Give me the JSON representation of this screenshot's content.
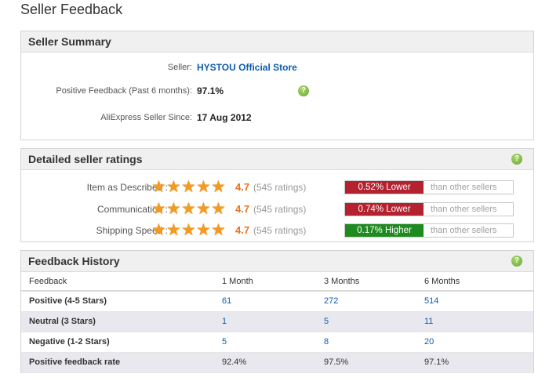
{
  "page": {
    "title": "Seller Feedback"
  },
  "summary": {
    "heading": "Seller Summary",
    "seller_label": "Seller:",
    "seller_name": "HYSTOU Official Store",
    "positive_label": "Positive Feedback (Past 6 months):",
    "positive_value": "97.1%",
    "since_label": "AliExpress Seller Since:",
    "since_value": "17 Aug 2012",
    "help_icon": "?"
  },
  "ratings": {
    "heading": "Detailed seller ratings",
    "help_icon": "?",
    "star_glyph": "★",
    "comparison_suffix": "than other sellers",
    "rows": [
      {
        "label": "Item as Described :",
        "score": "4.7",
        "stars": 4.7,
        "count": "(545 ratings)",
        "compare": "0.52% Lower",
        "direction": "lower"
      },
      {
        "label": "Communication :",
        "score": "4.7",
        "stars": 4.7,
        "count": "(545 ratings)",
        "compare": "0.74% Lower",
        "direction": "lower"
      },
      {
        "label": "Shipping Speed :",
        "score": "4.7",
        "stars": 4.7,
        "count": "(545 ratings)",
        "compare": "0.17% Higher",
        "direction": "higher"
      }
    ],
    "colors": {
      "lower": "#b5222f",
      "higher": "#1f8a1f",
      "star": "#f39a20",
      "score": "#ef6f1b"
    }
  },
  "history": {
    "heading": "Feedback History",
    "help_icon": "?",
    "columns": [
      "Feedback",
      "1 Month",
      "3 Months",
      "6 Months"
    ],
    "rows": [
      {
        "label": "Positive (4-5 Stars)",
        "values": [
          "61",
          "272",
          "514"
        ]
      },
      {
        "label": "Neutral (3 Stars)",
        "values": [
          "1",
          "5",
          "11"
        ]
      },
      {
        "label": "Negative (1-2 Stars)",
        "values": [
          "5",
          "8",
          "20"
        ]
      },
      {
        "label": "Positive feedback rate",
        "values": [
          "92.4%",
          "97.5%",
          "97.1%"
        ]
      }
    ]
  }
}
